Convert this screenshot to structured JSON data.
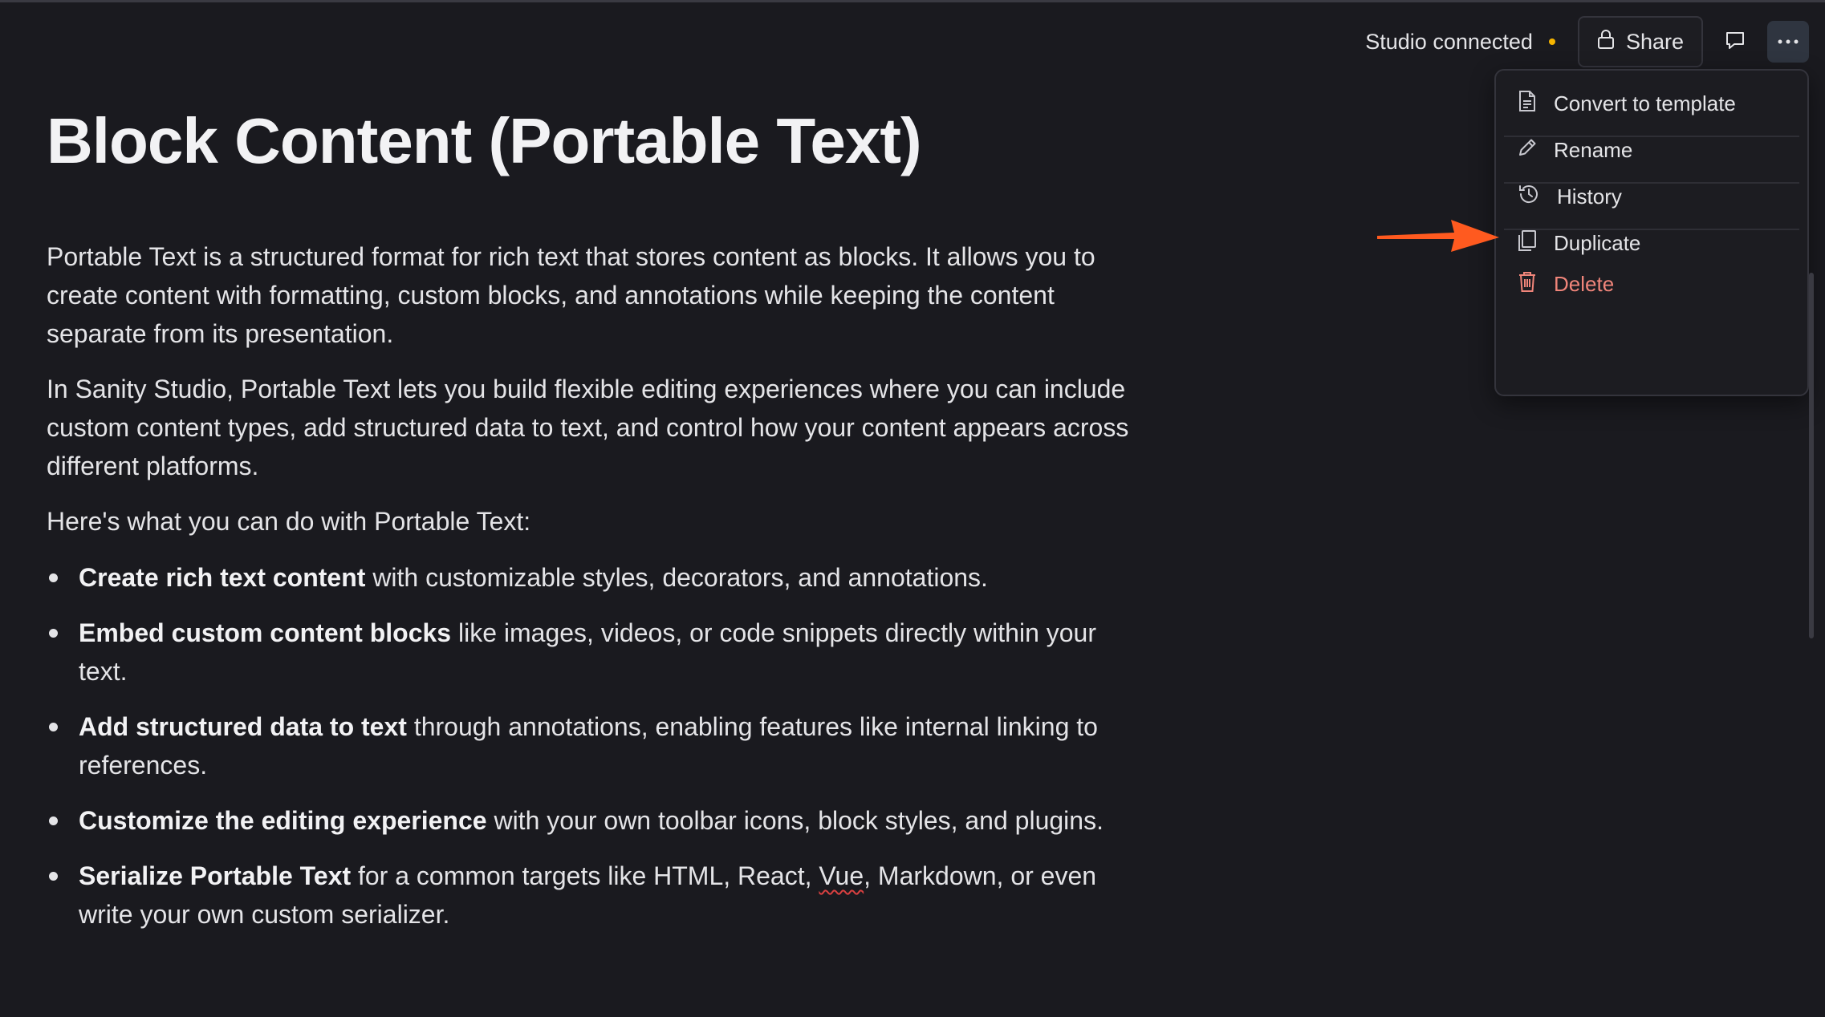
{
  "header": {
    "status_text": "Studio connected",
    "status_color": "#f5b400",
    "share_label": "Share",
    "share_icon": "lock-icon",
    "comment_icon": "comment-icon",
    "more_icon": "ellipsis-icon"
  },
  "menu": {
    "items": [
      {
        "label": "Convert to template",
        "icon": "document-template-icon"
      },
      {
        "label": "Rename",
        "icon": "pencil-icon"
      },
      {
        "label": "History",
        "icon": "history-icon"
      },
      {
        "label": "Duplicate",
        "icon": "duplicate-icon"
      },
      {
        "label": "Delete",
        "icon": "trash-icon",
        "color": "#f0857a"
      }
    ]
  },
  "annotation": {
    "icon": "arrow-icon",
    "color": "#ff5a1f"
  },
  "document": {
    "title": "Block Content (Portable Text)",
    "paragraphs": [
      "Portable Text is a structured format for rich text that stores content as blocks. It allows you to create content with formatting, custom blocks, and annotations while keeping the content separate from its presentation.",
      "In Sanity Studio, Portable Text lets you build flexible editing experiences where you can include custom content types, add structured data to text, and control how your content appears across different platforms.",
      "Here's what you can do with Portable Text:"
    ],
    "list": [
      {
        "bold": "Create rich text content",
        "text": " with customizable styles, decorators, and annotations."
      },
      {
        "bold": "Embed custom content blocks",
        "text": " like images, videos, or code snippets directly within your text."
      },
      {
        "bold": "Add structured data to text",
        "text": " through annotations, enabling features like internal linking to references."
      },
      {
        "bold": "Customize the editing experience",
        "text": " with your own toolbar icons, block styles, and plugins."
      },
      {
        "bold": "Serialize Portable Text",
        "text_before": " for a common targets like HTML, React, ",
        "flagged_word": "Vue",
        "text_after": ", Markdown, or even write your own custom serializer."
      }
    ]
  }
}
